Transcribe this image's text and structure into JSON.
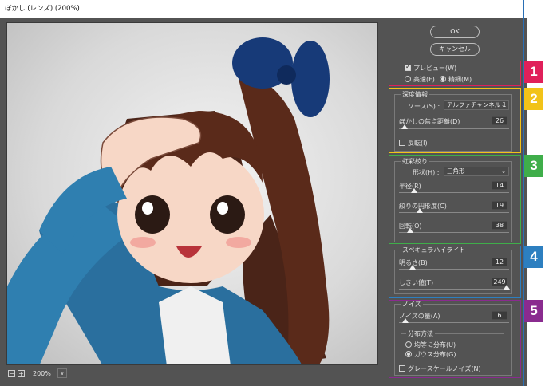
{
  "window": {
    "title": "ぼかし (レンズ) (200%)"
  },
  "buttons": {
    "ok": "OK",
    "cancel": "キャンセル"
  },
  "preview_opts": {
    "preview_label": "プレビュー(W)",
    "preview_checked": true,
    "fast_label": "高速(F)",
    "accurate_label": "精細(M)",
    "selected": "accurate"
  },
  "depth": {
    "title": "深度情報",
    "source_label": "ソース(S) :",
    "source_value": "アルファチャンネル 1",
    "focal_label": "ぼかしの焦点距離(D)",
    "focal_value": "26",
    "focal_frac": 0.05,
    "invert_label": "反転(I)"
  },
  "iris": {
    "title": "虹彩絞り",
    "shape_label": "形状(H) :",
    "shape_value": "三角形",
    "radius_label": "半径(R)",
    "radius_value": "14",
    "radius_frac": 0.14,
    "curvature_label": "絞りの円形度(C)",
    "curvature_value": "19",
    "curvature_frac": 0.19,
    "rotation_label": "回転(O)",
    "rotation_value": "38",
    "rotation_frac": 0.1
  },
  "specular": {
    "title": "スペキュラハイライト",
    "brightness_label": "明るさ(B)",
    "brightness_value": "12",
    "brightness_frac": 0.12,
    "threshold_label": "しきい値(T)",
    "threshold_value": "249",
    "threshold_frac": 0.98
  },
  "noise": {
    "title": "ノイズ",
    "amount_label": "ノイズの量(A)",
    "amount_value": "6",
    "amount_frac": 0.06,
    "dist_title": "分布方法",
    "uniform_label": "均等に分布(U)",
    "gaussian_label": "ガウス分布(G)",
    "selected": "gaussian",
    "mono_label": "グレースケールノイズ(N)"
  },
  "zoom": {
    "value": "200%",
    "minus": "−",
    "plus": "+",
    "caret": "∨"
  },
  "annotations": {
    "badges": [
      {
        "label": "1",
        "color": "#e0205a"
      },
      {
        "label": "2",
        "color": "#f2c318"
      },
      {
        "label": "3",
        "color": "#3fae4a"
      },
      {
        "label": "4",
        "color": "#2d7fc0"
      },
      {
        "label": "5",
        "color": "#8a2b8f"
      }
    ]
  }
}
